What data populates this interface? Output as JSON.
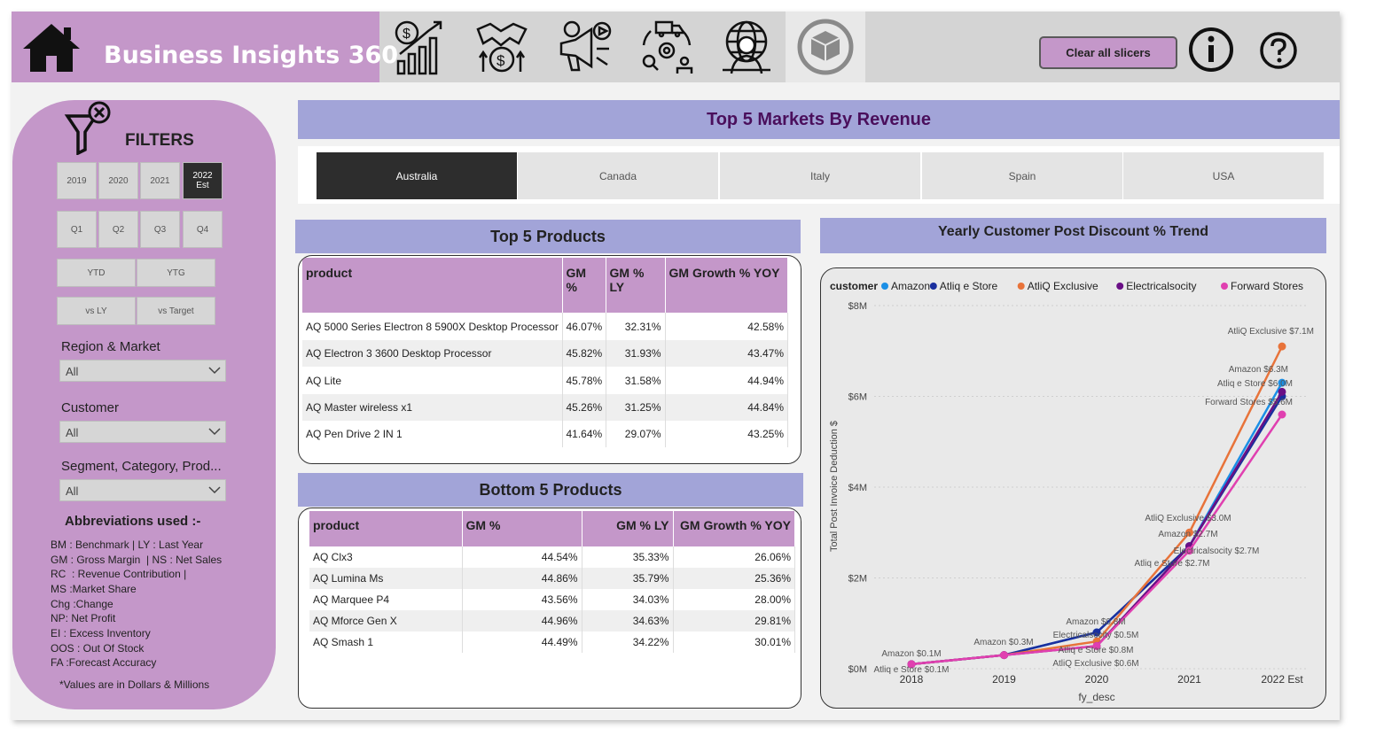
{
  "header": {
    "title": "Business Insights 360",
    "clear_button": "Clear all slicers"
  },
  "filters": {
    "title": "FILTERS",
    "years": [
      "2019",
      "2020",
      "2021",
      "2022\nEst"
    ],
    "selected_year": "2022 Est",
    "quarters": [
      "Q1",
      "Q2",
      "Q3",
      "Q4"
    ],
    "period": [
      "YTD",
      "YTG"
    ],
    "compare": [
      "vs LY",
      "vs Target"
    ],
    "region_label": "Region & Market",
    "region_value": "All",
    "customer_label": "Customer",
    "customer_value": "All",
    "segment_label": "Segment, Category, Prod...",
    "segment_value": "All",
    "abbr_title": "Abbreviations  used :-",
    "abbreviations": [
      "BM : Benchmark | LY : Last Year",
      "GM : Gross Margin  | NS : Net Sales",
      "RC  : Revenue Contribution |",
      "MS :Market Share",
      "Chg :Change",
      "NP: Net Profit",
      "EI : Excess Inventory",
      "OOS : Out Of Stock",
      "FA :Forecast Accuracy"
    ],
    "note": "*Values are in Dollars & Millions"
  },
  "markets": {
    "title": "Top  5  Markets   By Revenue",
    "items": [
      "Australia",
      "Canada",
      "Italy",
      "Spain",
      "USA"
    ],
    "selected": "Australia"
  },
  "top_products": {
    "title": "Top  5  Products",
    "headers": [
      "product",
      "GM\n%",
      "GM % LY",
      "GM Growth % YOY"
    ],
    "rows": [
      [
        "AQ 5000 Series Electron 8 5900X Desktop Processor",
        "46.07%",
        "32.31%",
        "42.58%"
      ],
      [
        "AQ Electron 3 3600 Desktop Processor",
        "45.82%",
        "31.93%",
        "43.47%"
      ],
      [
        "AQ Lite",
        "45.78%",
        "31.58%",
        "44.94%"
      ],
      [
        "AQ Master wireless x1",
        "45.26%",
        "31.25%",
        "44.84%"
      ],
      [
        "AQ Pen Drive 2 IN 1",
        "41.64%",
        "29.07%",
        "43.25%"
      ]
    ]
  },
  "bottom_products": {
    "title": "Bottom  5  Products",
    "headers": [
      "product",
      "GM %",
      "GM % LY",
      "GM Growth % YOY"
    ],
    "rows": [
      [
        "AQ Clx3",
        "44.54%",
        "35.33%",
        "26.06%"
      ],
      [
        "AQ Lumina Ms",
        "44.86%",
        "35.79%",
        "25.36%"
      ],
      [
        "AQ Marquee P4",
        "43.56%",
        "34.03%",
        "28.00%"
      ],
      [
        "AQ Mforce Gen X",
        "44.96%",
        "34.63%",
        "29.81%"
      ],
      [
        "AQ Smash 1",
        "44.49%",
        "34.22%",
        "30.01%"
      ]
    ]
  },
  "trend": {
    "title": "Yearly  Customer Post Discount % Trend"
  },
  "chart_data": {
    "type": "line",
    "title": "",
    "xlabel": "fy_desc",
    "ylabel": "Total Post Invoice Deduction $",
    "legend_title": "customer",
    "legend_position": "top-left",
    "categories": [
      "2018",
      "2019",
      "2020",
      "2021",
      "2022 Est"
    ],
    "yticks": [
      "$0M",
      "$2M",
      "$4M",
      "$6M",
      "$8M"
    ],
    "ylim": [
      0,
      8
    ],
    "series": [
      {
        "name": "Amazon",
        "color": "#1a8fe6",
        "values": [
          0.1,
          0.3,
          0.8,
          2.7,
          6.3
        ]
      },
      {
        "name": "Atliq e Store",
        "color": "#1a2f9e",
        "values": [
          0.1,
          0.3,
          0.8,
          2.7,
          6.0
        ]
      },
      {
        "name": "AtliQ Exclusive",
        "color": "#e8733a",
        "values": [
          0.1,
          0.3,
          0.6,
          3.0,
          7.1
        ]
      },
      {
        "name": "Electricalsocity",
        "color": "#6a0f86",
        "values": [
          0.1,
          0.3,
          0.5,
          2.7,
          6.1
        ]
      },
      {
        "name": "Forward Stores",
        "color": "#e040b0",
        "values": [
          0.1,
          0.3,
          0.5,
          2.6,
          5.6
        ]
      }
    ],
    "data_labels": [
      "Amazon $0.1M",
      "Atliq e Store $0.1M",
      "Amazon $0.3M",
      "Amazon $0.8M",
      "Electricalsocity $0.5M",
      "Atliq e Store $0.8M",
      "AtliQ Exclusive $0.6M",
      "AtliQ Exclusive $3.0M",
      "Amazon $2.7M",
      "Electricalsocity $2.7M",
      "Atliq e Store $2.7M",
      "AtliQ Exclusive $7.1M",
      "Amazon $6.3M",
      "Atliq e Store $6.0M",
      "Forward Stores $5.6M"
    ]
  }
}
